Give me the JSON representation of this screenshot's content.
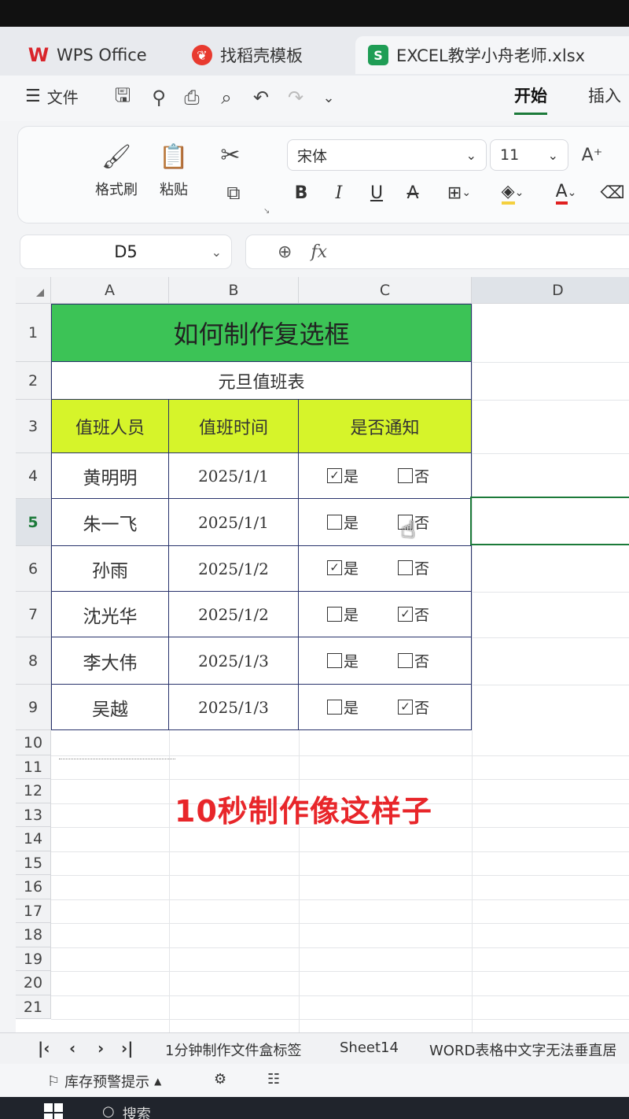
{
  "tabs": [
    {
      "label": "WPS Office",
      "icon": "wps-logo-icon",
      "color": "#d9242a"
    },
    {
      "label": "找稻壳模板",
      "icon": "docer-icon",
      "color": "#e83a2f"
    },
    {
      "label": "EXCEL教学小舟老师.xlsx",
      "icon": "sheet-icon",
      "color": "#1f9d55"
    }
  ],
  "menu": {
    "file_label": "文件",
    "ribbon_tabs": [
      "开始",
      "插入"
    ]
  },
  "ribbon": {
    "format_painter": "格式刷",
    "paste": "粘贴",
    "font_name": "宋体",
    "font_size": "11",
    "fmt": {
      "bold": "B",
      "italic": "I",
      "underline": "U",
      "strike": "A",
      "font_color": "A"
    }
  },
  "namebox": "D5",
  "formula": {
    "fx": "fx",
    "value": ""
  },
  "columns": [
    "A",
    "B",
    "C",
    "D"
  ],
  "rows": [
    "1",
    "2",
    "3",
    "4",
    "5",
    "6",
    "7",
    "8",
    "9",
    "10",
    "11",
    "12",
    "13",
    "14",
    "15",
    "16",
    "17",
    "18",
    "19",
    "20",
    "21"
  ],
  "sheet": {
    "title": "如何制作复选框",
    "subtitle": "元旦值班表",
    "headers": [
      "值班人员",
      "值班时间",
      "是否通知"
    ],
    "data": [
      {
        "name": "黄明明",
        "date": "2025/1/1",
        "yes_label": "是",
        "no_label": "否",
        "yes_checked": true,
        "no_checked": false
      },
      {
        "name": "朱一飞",
        "date": "2025/1/1",
        "yes_label": "是",
        "no_label": "否",
        "yes_checked": false,
        "no_checked": false
      },
      {
        "name": "孙雨",
        "date": "2025/1/2",
        "yes_label": "是",
        "no_label": "否",
        "yes_checked": true,
        "no_checked": false
      },
      {
        "name": "沈光华",
        "date": "2025/1/2",
        "yes_label": "是",
        "no_label": "否",
        "yes_checked": false,
        "no_checked": true
      },
      {
        "name": "李大伟",
        "date": "2025/1/3",
        "yes_label": "是",
        "no_label": "否",
        "yes_checked": false,
        "no_checked": false
      },
      {
        "name": "吴越",
        "date": "2025/1/3",
        "yes_label": "是",
        "no_label": "否",
        "yes_checked": false,
        "no_checked": true
      }
    ]
  },
  "caption": "10秒制作像这样子",
  "sheet_tabs": [
    "1分钟制作文件盒标签",
    "Sheet14",
    "WORD表格中文字无法垂直居"
  ],
  "status": {
    "alert": "库存预警提示"
  },
  "taskbar": {
    "search": "搜索"
  },
  "colors": {
    "title_bg": "#3cc356",
    "header_bg": "#d6f42a",
    "caption": "#e8262a",
    "accent": "#1c7a3a"
  }
}
